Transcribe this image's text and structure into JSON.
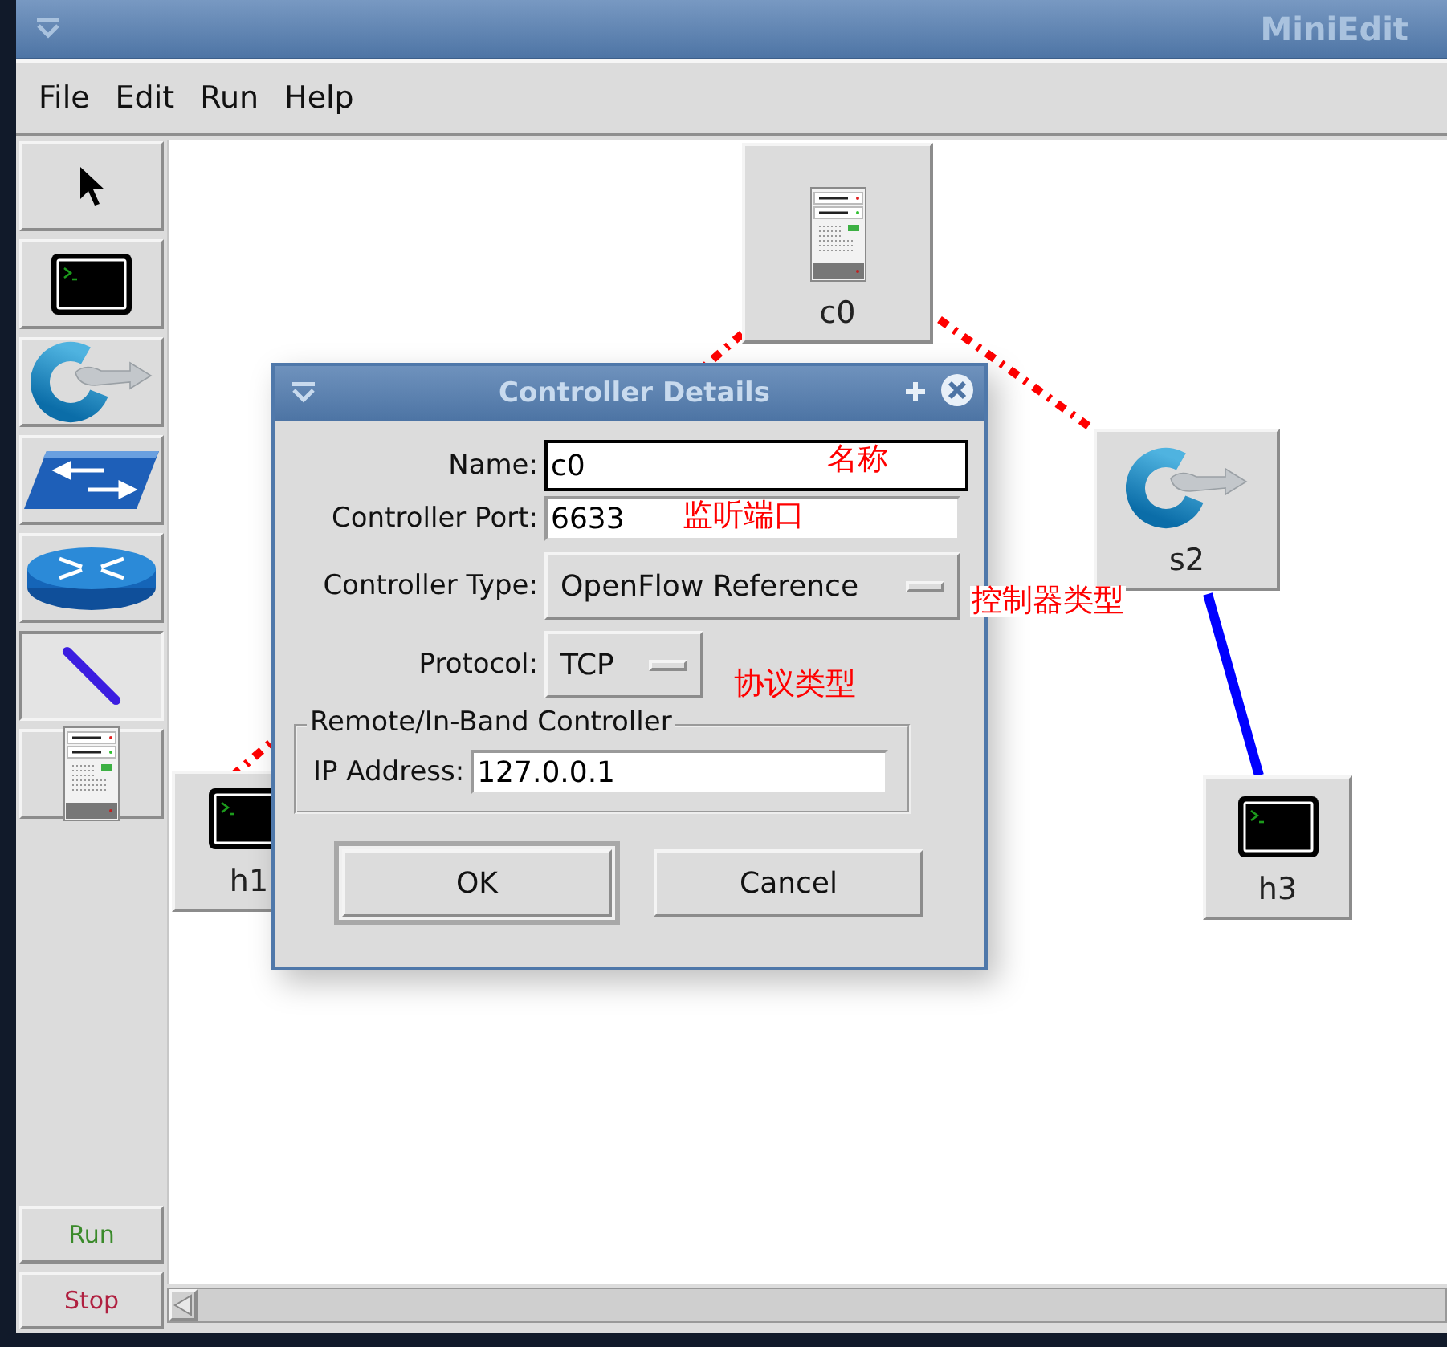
{
  "window": {
    "title": "MiniEdit"
  },
  "menu": [
    {
      "label": "File"
    },
    {
      "label": "Edit"
    },
    {
      "label": "Run"
    },
    {
      "label": "Help"
    }
  ],
  "toolbar": {
    "tools": [
      {
        "kind": "select",
        "selected": false
      },
      {
        "kind": "host",
        "selected": false
      },
      {
        "kind": "switch",
        "selected": false
      },
      {
        "kind": "legacy-switch",
        "selected": false
      },
      {
        "kind": "legacy-router",
        "selected": false
      },
      {
        "kind": "link",
        "selected": true
      },
      {
        "kind": "controller",
        "selected": false
      }
    ],
    "run": "Run",
    "stop": "Stop"
  },
  "canvas": {
    "nodes": [
      {
        "kind": "controller",
        "label": "c0"
      },
      {
        "kind": "switch",
        "label": "s2"
      },
      {
        "kind": "host",
        "label": "h1"
      },
      {
        "kind": "host",
        "label": "h3"
      }
    ],
    "links": [
      {
        "kind": "control"
      },
      {
        "kind": "control"
      },
      {
        "kind": "data"
      }
    ]
  },
  "dialog": {
    "title": "Controller Details",
    "fields": [
      {
        "kind": "text",
        "label": "Name:",
        "value": "c0",
        "focused": true
      },
      {
        "kind": "text",
        "label": "Controller Port:",
        "value": "6633",
        "focused": false
      },
      {
        "kind": "select",
        "label": "Controller Type:",
        "value": "OpenFlow Reference"
      },
      {
        "kind": "select",
        "label": "Protocol:",
        "value": "TCP"
      }
    ],
    "group": {
      "title": "Remote/In-Band Controller",
      "fields": [
        {
          "kind": "text",
          "label": "IP Address:",
          "value": "127.0.0.1",
          "focused": false
        }
      ]
    },
    "buttons": [
      {
        "label": "OK",
        "default": true
      },
      {
        "label": "Cancel",
        "default": false
      }
    ]
  },
  "annotations": [
    {
      "text": "名称"
    },
    {
      "text": "监听端口"
    },
    {
      "text": "控制器类型"
    },
    {
      "text": "协议类型"
    }
  ]
}
